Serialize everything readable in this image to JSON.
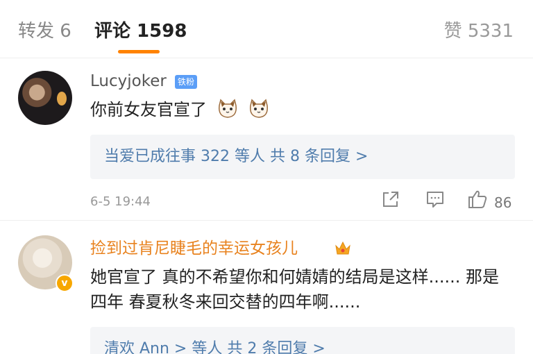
{
  "tabs": {
    "repost": "转发 6",
    "comments": "评论 1598",
    "likes": "赞 5331"
  },
  "comments": [
    {
      "username": "Lucyjoker",
      "badge": "铁粉",
      "text": "你前女友官宣了",
      "reply_summary": "当爱已成往事 322 等人  共 8 条回复 >",
      "time": "6-5 19:44",
      "like_count": "86"
    },
    {
      "username": "捡到过肯尼睫毛的幸运女孩儿",
      "text": "她官宣了 真的不希望你和何婧婧的结局是这样...... 那是四年 春夏秋冬来回交替的四年啊......",
      "reply_summary": "清欢 Ann > 等人  共 2 条回复 >"
    }
  ],
  "colors": {
    "accent": "#ff8200",
    "link": "#4f7cac",
    "vip_name": "#e8821e"
  }
}
